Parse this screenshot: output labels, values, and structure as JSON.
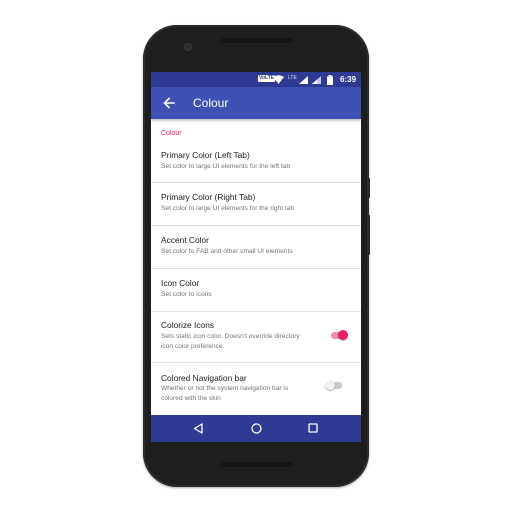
{
  "statusbar": {
    "volte": "VoLTE",
    "network": "LTE",
    "time": "6:39"
  },
  "toolbar": {
    "title": "Colour",
    "back_icon": "arrow-back-icon"
  },
  "section": {
    "header": "Colour"
  },
  "preferences": [
    {
      "title": "Primary Color (Left Tab)",
      "summary": "Set color to large UI elements for the left tab"
    },
    {
      "title": "Primary Color (Right Tab)",
      "summary": "Set color to large UI elements for the right tab"
    },
    {
      "title": "Accent Color",
      "summary": "Set color to FAB and other small UI elements"
    },
    {
      "title": "Icon Color",
      "summary": "Set color to icons"
    },
    {
      "title": "Colorize Icons",
      "summary": "Sets static icon color. Doesn't override directory icon color preference.",
      "switch_on": true
    },
    {
      "title": "Colored Navigation bar",
      "summary": "Whether or not the system navigation bar is colored with the skin",
      "switch_on": false
    }
  ],
  "navigation": {
    "back_icon": "nav-back-triangle-icon",
    "home_icon": "nav-home-circle-icon",
    "recents_icon": "nav-recents-square-icon"
  },
  "colors": {
    "primary": "#3f51b5",
    "primary_dark": "#2f3b93",
    "accent": "#e91e63",
    "switch_off": "#bdbdbd"
  }
}
